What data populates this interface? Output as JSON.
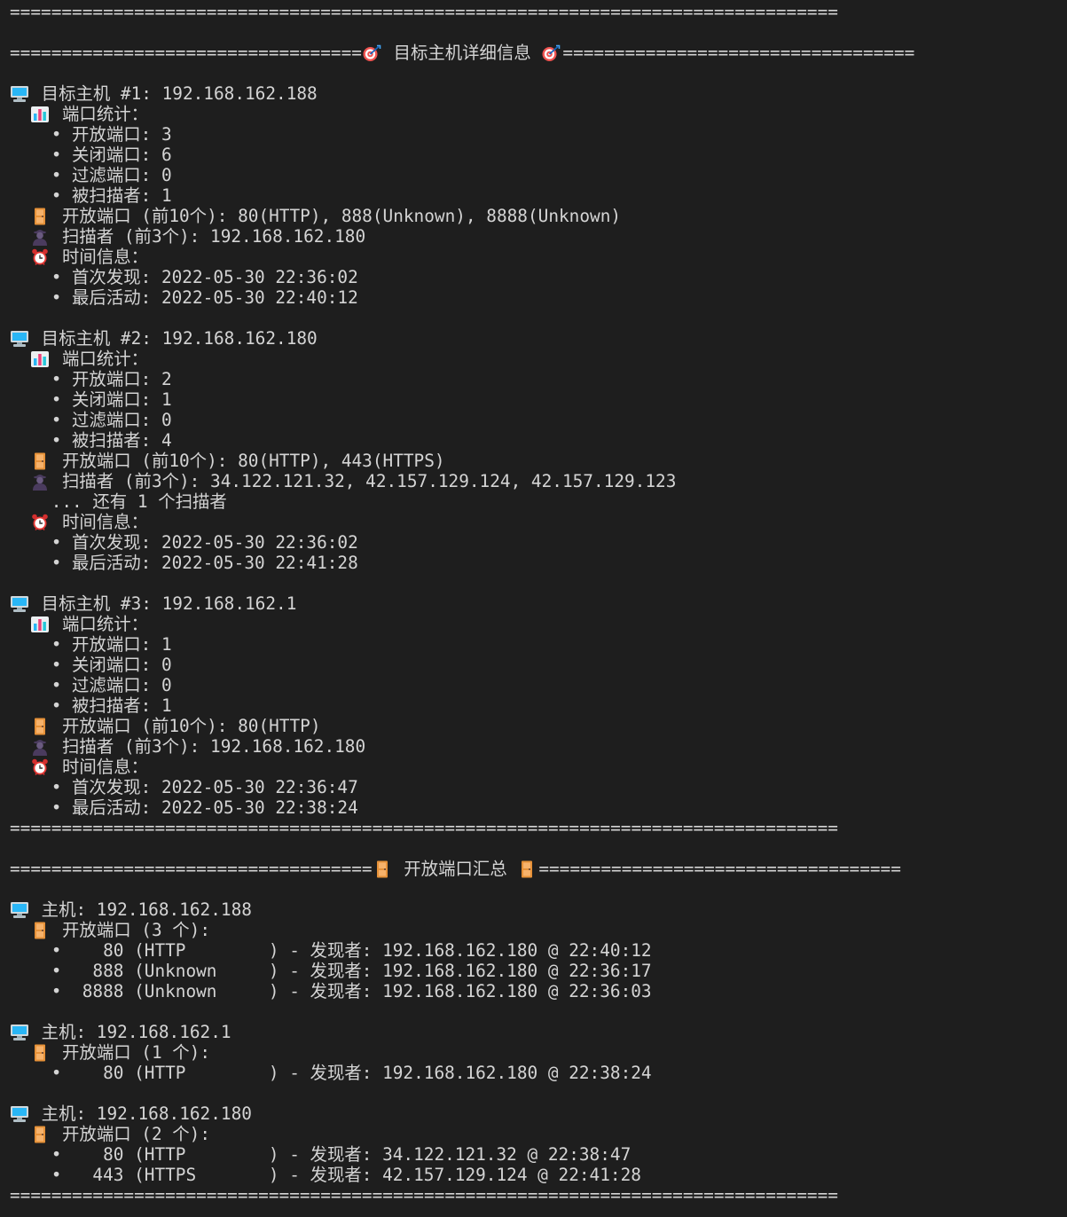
{
  "terminal": {
    "lines": [
      {
        "icon": null,
        "text": "================================================================================"
      },
      {
        "icon": null,
        "text": ""
      },
      {
        "icon": null,
        "text": "==================================",
        "icon_mid": "target-icon",
        "text2": " 目标主机详细信息 ",
        "icon_end": "target-icon",
        "text3": "=================================="
      },
      {
        "icon": null,
        "text": ""
      },
      {
        "icon": "computer-icon",
        "indent": "",
        "text": " 目标主机 #1: 192.168.162.188"
      },
      {
        "icon": "bar-chart-icon",
        "indent": "  ",
        "text": " 端口统计："
      },
      {
        "icon": null,
        "text": "    • 开放端口: 3"
      },
      {
        "icon": null,
        "text": "    • 关闭端口: 6"
      },
      {
        "icon": null,
        "text": "    • 过滤端口: 0"
      },
      {
        "icon": null,
        "text": "    • 被扫描者: 1"
      },
      {
        "icon": "door-icon",
        "indent": "  ",
        "text": " 开放端口 (前10个): 80(HTTP), 888(Unknown), 8888(Unknown)"
      },
      {
        "icon": "spy-icon",
        "indent": "  ",
        "text": " 扫描者 (前3个): 192.168.162.180"
      },
      {
        "icon": "alarm-clock-icon",
        "indent": "  ",
        "text": " 时间信息："
      },
      {
        "icon": null,
        "text": "    • 首次发现: 2022-05-30 22:36:02"
      },
      {
        "icon": null,
        "text": "    • 最后活动: 2022-05-30 22:40:12"
      },
      {
        "icon": null,
        "text": ""
      },
      {
        "icon": "computer-icon",
        "indent": "",
        "text": " 目标主机 #2: 192.168.162.180"
      },
      {
        "icon": "bar-chart-icon",
        "indent": "  ",
        "text": " 端口统计："
      },
      {
        "icon": null,
        "text": "    • 开放端口: 2"
      },
      {
        "icon": null,
        "text": "    • 关闭端口: 1"
      },
      {
        "icon": null,
        "text": "    • 过滤端口: 0"
      },
      {
        "icon": null,
        "text": "    • 被扫描者: 4"
      },
      {
        "icon": "door-icon",
        "indent": "  ",
        "text": " 开放端口 (前10个): 80(HTTP), 443(HTTPS)"
      },
      {
        "icon": "spy-icon",
        "indent": "  ",
        "text": " 扫描者 (前3个): 34.122.121.32, 42.157.129.124, 42.157.129.123"
      },
      {
        "icon": null,
        "text": "    ... 还有 1 个扫描者"
      },
      {
        "icon": "alarm-clock-icon",
        "indent": "  ",
        "text": " 时间信息："
      },
      {
        "icon": null,
        "text": "    • 首次发现: 2022-05-30 22:36:02"
      },
      {
        "icon": null,
        "text": "    • 最后活动: 2022-05-30 22:41:28"
      },
      {
        "icon": null,
        "text": ""
      },
      {
        "icon": "computer-icon",
        "indent": "",
        "text": " 目标主机 #3: 192.168.162.1"
      },
      {
        "icon": "bar-chart-icon",
        "indent": "  ",
        "text": " 端口统计："
      },
      {
        "icon": null,
        "text": "    • 开放端口: 1"
      },
      {
        "icon": null,
        "text": "    • 关闭端口: 0"
      },
      {
        "icon": null,
        "text": "    • 过滤端口: 0"
      },
      {
        "icon": null,
        "text": "    • 被扫描者: 1"
      },
      {
        "icon": "door-icon",
        "indent": "  ",
        "text": " 开放端口 (前10个): 80(HTTP)"
      },
      {
        "icon": "spy-icon",
        "indent": "  ",
        "text": " 扫描者 (前3个): 192.168.162.180"
      },
      {
        "icon": "alarm-clock-icon",
        "indent": "  ",
        "text": " 时间信息："
      },
      {
        "icon": null,
        "text": "    • 首次发现: 2022-05-30 22:36:47"
      },
      {
        "icon": null,
        "text": "    • 最后活动: 2022-05-30 22:38:24"
      },
      {
        "icon": null,
        "text": "================================================================================"
      },
      {
        "icon": null,
        "text": ""
      },
      {
        "icon": null,
        "text": "===================================",
        "icon_mid": "door-icon",
        "text2": " 开放端口汇总 ",
        "icon_end": "door-icon",
        "text3": "==================================="
      },
      {
        "icon": null,
        "text": ""
      },
      {
        "icon": "computer-icon",
        "indent": "",
        "text": " 主机: 192.168.162.188"
      },
      {
        "icon": "door-icon",
        "indent": "  ",
        "text": " 开放端口 (3 个):"
      },
      {
        "icon": null,
        "text": "    •    80 (HTTP        ) - 发现者: 192.168.162.180 @ 22:40:12"
      },
      {
        "icon": null,
        "text": "    •   888 (Unknown     ) - 发现者: 192.168.162.180 @ 22:36:17"
      },
      {
        "icon": null,
        "text": "    •  8888 (Unknown     ) - 发现者: 192.168.162.180 @ 22:36:03"
      },
      {
        "icon": null,
        "text": ""
      },
      {
        "icon": "computer-icon",
        "indent": "",
        "text": " 主机: 192.168.162.1"
      },
      {
        "icon": "door-icon",
        "indent": "  ",
        "text": " 开放端口 (1 个):"
      },
      {
        "icon": null,
        "text": "    •    80 (HTTP        ) - 发现者: 192.168.162.180 @ 22:38:24"
      },
      {
        "icon": null,
        "text": ""
      },
      {
        "icon": "computer-icon",
        "indent": "",
        "text": " 主机: 192.168.162.180"
      },
      {
        "icon": "door-icon",
        "indent": "  ",
        "text": " 开放端口 (2 个):"
      },
      {
        "icon": null,
        "text": "    •    80 (HTTP        ) - 发现者: 34.122.121.32 @ 22:38:47"
      },
      {
        "icon": null,
        "text": "    •   443 (HTTPS       ) - 发现者: 42.157.129.124 @ 22:41:28"
      },
      {
        "icon": null,
        "text": "================================================================================"
      }
    ]
  },
  "colors": {
    "background": "#1e1e1e",
    "text": "#d4d4d4"
  }
}
